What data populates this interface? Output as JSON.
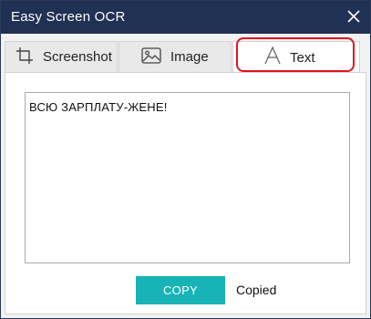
{
  "window": {
    "title": "Easy Screen OCR"
  },
  "tabs": [
    {
      "label": "Screenshot",
      "icon": "crop-icon"
    },
    {
      "label": "Image",
      "icon": "image-icon"
    },
    {
      "label": "Text",
      "icon": "text-icon",
      "selected": true
    }
  ],
  "main": {
    "text_content": "ВСЮ ЗАРПЛАТУ-ЖЕНЕ!",
    "copy_label": "COPY",
    "status": "Copied"
  },
  "colors": {
    "titlebar": "#1f3254",
    "accent": "#17b3b6",
    "highlight": "#e0141e"
  }
}
